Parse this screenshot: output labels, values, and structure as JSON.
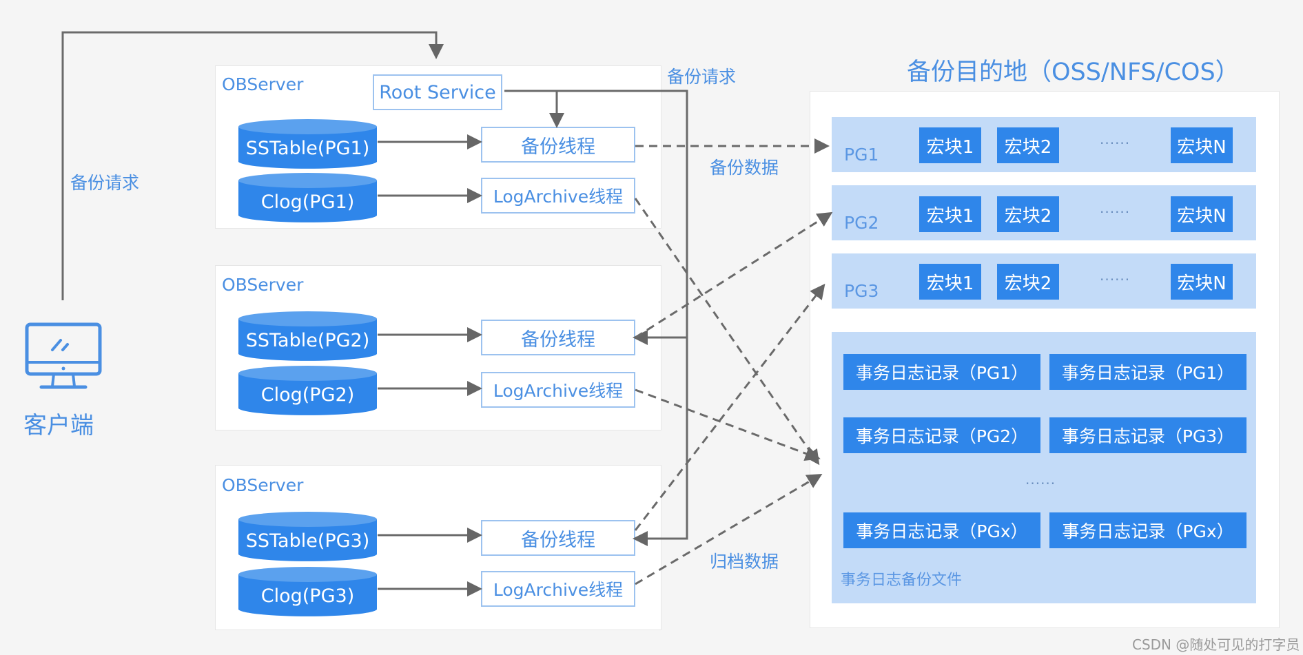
{
  "client": {
    "label": "客户端",
    "icon": "monitor-icon",
    "request_label": "备份请求"
  },
  "root_request_label": "备份请求",
  "observers": [
    {
      "title": "OBServer",
      "root_service": "Root Service",
      "sstable": "SSTable(PG1)",
      "clog": "Clog(PG1)",
      "backup_thread": "备份线程",
      "logarchive_thread": "LogArchive线程"
    },
    {
      "title": "OBServer",
      "sstable": "SSTable(PG2)",
      "clog": "Clog(PG2)",
      "backup_thread": "备份线程",
      "logarchive_thread": "LogArchive线程"
    },
    {
      "title": "OBServer",
      "sstable": "SSTable(PG3)",
      "clog": "Clog(PG3)",
      "backup_thread": "备份线程",
      "logarchive_thread": "LogArchive线程"
    }
  ],
  "flow_labels": {
    "backup_data": "备份数据",
    "archive_data": "归档数据"
  },
  "destination": {
    "title": "备份目的地（OSS/NFS/COS）",
    "pg_rows": [
      {
        "label": "PG1",
        "blocks": [
          "宏块1",
          "宏块2",
          "宏块N"
        ],
        "ellipsis": "······"
      },
      {
        "label": "PG2",
        "blocks": [
          "宏块1",
          "宏块2",
          "宏块N"
        ],
        "ellipsis": "······"
      },
      {
        "label": "PG3",
        "blocks": [
          "宏块1",
          "宏块2",
          "宏块N"
        ],
        "ellipsis": "······"
      }
    ],
    "log_files": {
      "records": [
        [
          "事务日志记录（PG1）",
          "事务日志记录（PG1）"
        ],
        [
          "事务日志记录（PG2）",
          "事务日志记录（PG3）"
        ],
        [
          "事务日志记录（PGx）",
          "事务日志记录（PGx）"
        ]
      ],
      "ellipsis": "······",
      "caption": "事务日志备份文件"
    }
  },
  "colors": {
    "primary_blue": "#2f86ea",
    "light_blue": "#c3dbf8",
    "text_blue": "#4a8fe2",
    "arrow_gray": "#666666",
    "background": "#f5f5f5"
  },
  "watermark": "CSDN @随处可见的打字员"
}
